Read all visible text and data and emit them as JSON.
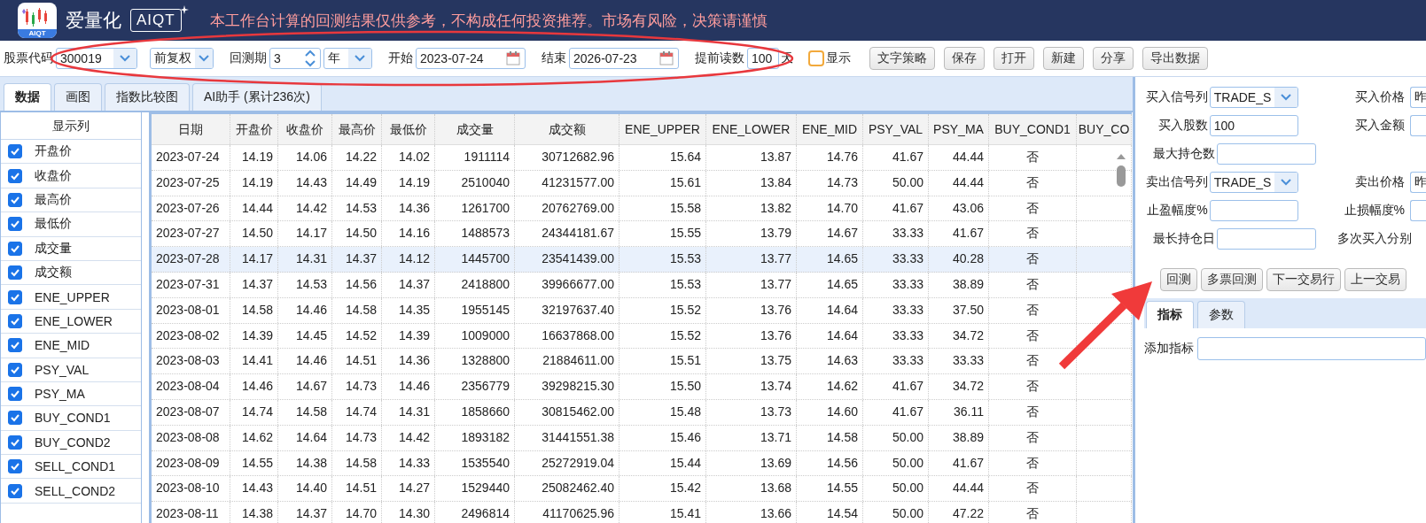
{
  "header": {
    "logo_badge": "AIQT",
    "app_name": "爱量化",
    "brand": "AIQT",
    "notice": "本工作台计算的回测结果仅供参考，不构成任何投资推荐。市场有风险，决策请谨慎"
  },
  "toolbar": {
    "items": [
      {
        "kind": "select",
        "label": "股票代码",
        "value": "300019"
      },
      {
        "kind": "select",
        "value": "前复权"
      },
      {
        "kind": "spinner",
        "label": "回测期",
        "value": "3"
      },
      {
        "kind": "select",
        "value": "年"
      },
      {
        "kind": "date",
        "label": "开始",
        "value": "2023-07-24"
      },
      {
        "kind": "date",
        "label": "结束",
        "value": "2026-07-23"
      },
      {
        "kind": "input",
        "label": "提前读数",
        "value": "100",
        "suffix": "天"
      },
      {
        "kind": "checkbox",
        "label": "显示",
        "checked": false
      }
    ],
    "buttons": [
      "文字策略",
      "保存",
      "打开",
      "新建",
      "分享",
      "导出数据"
    ]
  },
  "tabs": [
    {
      "label": "数据",
      "selected": true
    },
    {
      "label": "画图",
      "selected": false
    },
    {
      "label": "指数比较图",
      "selected": false
    },
    {
      "label": "AI助手 (累计236次)",
      "selected": false
    }
  ],
  "column_list": {
    "title": "显示列",
    "items": [
      {
        "label": "开盘价",
        "checked": true
      },
      {
        "label": "收盘价",
        "checked": true
      },
      {
        "label": "最高价",
        "checked": true
      },
      {
        "label": "最低价",
        "checked": true
      },
      {
        "label": "成交量",
        "checked": true
      },
      {
        "label": "成交额",
        "checked": true
      },
      {
        "label": "ENE_UPPER",
        "checked": true
      },
      {
        "label": "ENE_LOWER",
        "checked": true
      },
      {
        "label": "ENE_MID",
        "checked": true
      },
      {
        "label": "PSY_VAL",
        "checked": true
      },
      {
        "label": "PSY_MA",
        "checked": true
      },
      {
        "label": "BUY_COND1",
        "checked": true
      },
      {
        "label": "BUY_COND2",
        "checked": true
      },
      {
        "label": "SELL_COND1",
        "checked": true
      },
      {
        "label": "SELL_COND2",
        "checked": true
      }
    ]
  },
  "table": {
    "columns": [
      "日期",
      "开盘价",
      "收盘价",
      "最高价",
      "最低价",
      "成交量",
      "成交额",
      "ENE_UPPER",
      "ENE_LOWER",
      "ENE_MID",
      "PSY_VAL",
      "PSY_MA",
      "BUY_COND1",
      "BUY_CO"
    ],
    "rows": [
      {
        "selected": false,
        "cells": [
          "2023-07-24",
          "14.19",
          "14.06",
          "14.22",
          "14.02",
          "1911114",
          "30712682.96",
          "15.64",
          "13.87",
          "14.76",
          "41.67",
          "44.44",
          "否"
        ]
      },
      {
        "selected": false,
        "cells": [
          "2023-07-25",
          "14.19",
          "14.43",
          "14.49",
          "14.19",
          "2510040",
          "41231577.00",
          "15.61",
          "13.84",
          "14.73",
          "50.00",
          "44.44",
          "否"
        ]
      },
      {
        "selected": false,
        "cells": [
          "2023-07-26",
          "14.44",
          "14.42",
          "14.53",
          "14.36",
          "1261700",
          "20762769.00",
          "15.58",
          "13.82",
          "14.70",
          "41.67",
          "43.06",
          "否"
        ]
      },
      {
        "selected": false,
        "cells": [
          "2023-07-27",
          "14.50",
          "14.17",
          "14.50",
          "14.16",
          "1488573",
          "24344181.67",
          "15.55",
          "13.79",
          "14.67",
          "33.33",
          "41.67",
          "否"
        ]
      },
      {
        "selected": true,
        "cells": [
          "2023-07-28",
          "14.17",
          "14.31",
          "14.37",
          "14.12",
          "1445700",
          "23541439.00",
          "15.53",
          "13.77",
          "14.65",
          "33.33",
          "40.28",
          "否"
        ]
      },
      {
        "selected": false,
        "cells": [
          "2023-07-31",
          "14.37",
          "14.53",
          "14.56",
          "14.37",
          "2418800",
          "39966677.00",
          "15.53",
          "13.77",
          "14.65",
          "33.33",
          "38.89",
          "否"
        ]
      },
      {
        "selected": false,
        "cells": [
          "2023-08-01",
          "14.58",
          "14.46",
          "14.58",
          "14.35",
          "1955145",
          "32197637.40",
          "15.52",
          "13.76",
          "14.64",
          "33.33",
          "37.50",
          "否"
        ]
      },
      {
        "selected": false,
        "cells": [
          "2023-08-02",
          "14.39",
          "14.45",
          "14.52",
          "14.39",
          "1009000",
          "16637868.00",
          "15.52",
          "13.76",
          "14.64",
          "33.33",
          "34.72",
          "否"
        ]
      },
      {
        "selected": false,
        "cells": [
          "2023-08-03",
          "14.41",
          "14.46",
          "14.51",
          "14.36",
          "1328800",
          "21884611.00",
          "15.51",
          "13.75",
          "14.63",
          "33.33",
          "33.33",
          "否"
        ]
      },
      {
        "selected": false,
        "cells": [
          "2023-08-04",
          "14.46",
          "14.67",
          "14.73",
          "14.46",
          "2356779",
          "39298215.30",
          "15.50",
          "13.74",
          "14.62",
          "41.67",
          "34.72",
          "否"
        ]
      },
      {
        "selected": false,
        "cells": [
          "2023-08-07",
          "14.74",
          "14.58",
          "14.74",
          "14.31",
          "1858660",
          "30815462.00",
          "15.48",
          "13.73",
          "14.60",
          "41.67",
          "36.11",
          "否"
        ]
      },
      {
        "selected": false,
        "cells": [
          "2023-08-08",
          "14.62",
          "14.64",
          "14.73",
          "14.42",
          "1893182",
          "31441551.38",
          "15.46",
          "13.71",
          "14.58",
          "50.00",
          "38.89",
          "否"
        ]
      },
      {
        "selected": false,
        "cells": [
          "2023-08-09",
          "14.55",
          "14.38",
          "14.58",
          "14.33",
          "1535540",
          "25272919.04",
          "15.44",
          "13.69",
          "14.56",
          "50.00",
          "41.67",
          "否"
        ]
      },
      {
        "selected": false,
        "cells": [
          "2023-08-10",
          "14.43",
          "14.40",
          "14.51",
          "14.27",
          "1529440",
          "25082462.40",
          "15.42",
          "13.68",
          "14.55",
          "50.00",
          "44.44",
          "否"
        ]
      },
      {
        "selected": false,
        "cells": [
          "2023-08-11",
          "14.38",
          "14.37",
          "14.70",
          "14.30",
          "2496814",
          "41170625.96",
          "15.41",
          "13.66",
          "14.54",
          "50.00",
          "47.22",
          "否"
        ]
      }
    ]
  },
  "form": {
    "rows": [
      [
        {
          "kind": "select",
          "label": "买入信号列",
          "value": "TRADE_S"
        },
        {
          "kind": "input",
          "label": "买入价格",
          "value": "昨"
        }
      ],
      [
        {
          "kind": "input",
          "label": "买入股数",
          "value": "100"
        },
        {
          "kind": "input",
          "label": "买入金额"
        }
      ],
      [
        {
          "kind": "input",
          "label": "最大持仓数"
        }
      ],
      [
        {
          "kind": "select",
          "label": "卖出信号列",
          "value": "TRADE_S"
        },
        {
          "kind": "input",
          "label": "卖出价格",
          "value": "昨"
        }
      ],
      [
        {
          "kind": "input",
          "label": "止盈幅度%"
        },
        {
          "kind": "input",
          "label": "止损幅度%"
        }
      ],
      [
        {
          "kind": "input",
          "label": "最长持仓日"
        },
        {
          "kind": "note",
          "label": "多次买入分别"
        }
      ]
    ],
    "buttons": [
      "回测",
      "多票回测",
      "下一交易行",
      "上一交易"
    ]
  },
  "sub_tabs": [
    {
      "label": "指标",
      "selected": true
    },
    {
      "label": "参数",
      "selected": false
    }
  ],
  "indicator": {
    "label": "添加指标"
  }
}
